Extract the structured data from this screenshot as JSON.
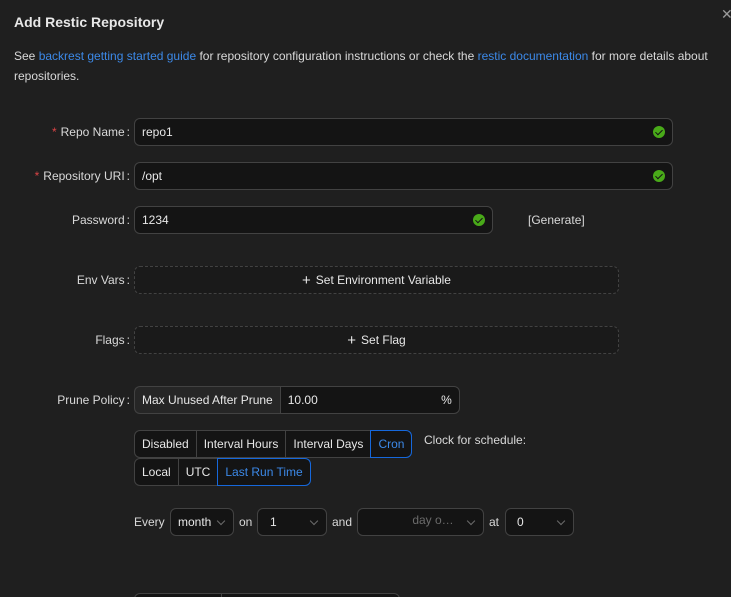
{
  "modal": {
    "title": "Add Restic Repository"
  },
  "intro": {
    "see": "See ",
    "link1": "backrest getting started guide",
    "mid": " for repository configuration instructions or check the ",
    "link2": "restic documentation",
    "end": " for more details about repositories."
  },
  "form": {
    "repo_name": {
      "label": "Repo Name",
      "value": "repo1",
      "required": true
    },
    "repo_uri": {
      "label": "Repository URI",
      "value": "/opt",
      "required": true
    },
    "password": {
      "label": "Password",
      "value": "1234",
      "generate": "[Generate]"
    },
    "env_vars": {
      "label": "Env Vars",
      "button": "Set Environment Variable"
    },
    "flags": {
      "label": "Flags",
      "button": "Set Flag"
    },
    "prune": {
      "label": "Prune Policy",
      "addon": "Max Unused After Prune",
      "value": "10.00",
      "unit": "%"
    },
    "schedule": {
      "modes": [
        "Disabled",
        "Interval Hours",
        "Interval Days",
        "Cron"
      ],
      "active_mode": "Cron",
      "clock_label": "Clock for schedule:",
      "clocks": [
        "Local",
        "UTC",
        "Last Run Time"
      ],
      "active_clock": "Last Run Time",
      "cron": {
        "every": "Every",
        "period": "month",
        "on": "on",
        "day": "1",
        "and": "and",
        "weekday_placeholder": "day o…",
        "at": "at",
        "hour": "0"
      }
    }
  },
  "colors": {
    "accent": "#3c89e8",
    "success": "#49aa19",
    "required": "#dc4446"
  }
}
